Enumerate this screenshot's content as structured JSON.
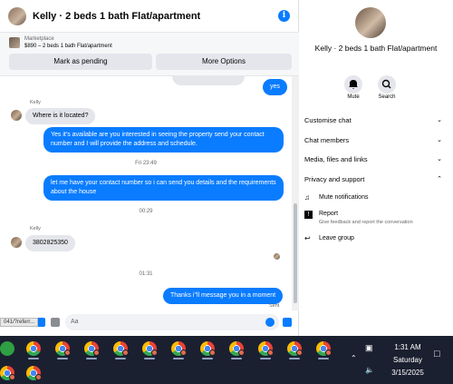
{
  "header": {
    "title": "Kelly · 2 beds 1 bath Flat/apartment"
  },
  "marketplace": {
    "label": "Marketplace",
    "listing": "$890 – 2 beds 1 bath Flat/apartment",
    "buttons": [
      "Mark as pending",
      "More Options"
    ]
  },
  "messages": {
    "yes": "yes",
    "sender1": "Kelly",
    "in1": "Where is it located?",
    "out1": "Yes it's available are you interested in seeing the property send your contact number and I will provide the address and schedule.",
    "ts1": "Fri 23:49",
    "out2": "let me have your contact number so i can send you details and the requirements about the house",
    "ts2": "00:29",
    "sender2": "Kelly",
    "in2": "3802825350",
    "ts3": "01:31",
    "out3": "Thanks i\"ll message you in a moment",
    "status": "Sent"
  },
  "composer": {
    "placeholder": "Aa"
  },
  "sidebar": {
    "title": "Kelly · 2 beds 1 bath Flat/apartment",
    "mute": "Mute",
    "search": "Search",
    "rows": [
      "Customise chat",
      "Chat members",
      "Media, files and links",
      "Privacy and support"
    ],
    "notifications": "Mute notifications",
    "report": "Report",
    "report_desc": "Give feedback and report the conversation",
    "leave": "Leave group"
  },
  "address_bar": {
    "text": "041/?referr..."
  },
  "taskbar": {
    "time": "1:31 AM",
    "day": "Saturday",
    "date": "3/15/2025"
  }
}
